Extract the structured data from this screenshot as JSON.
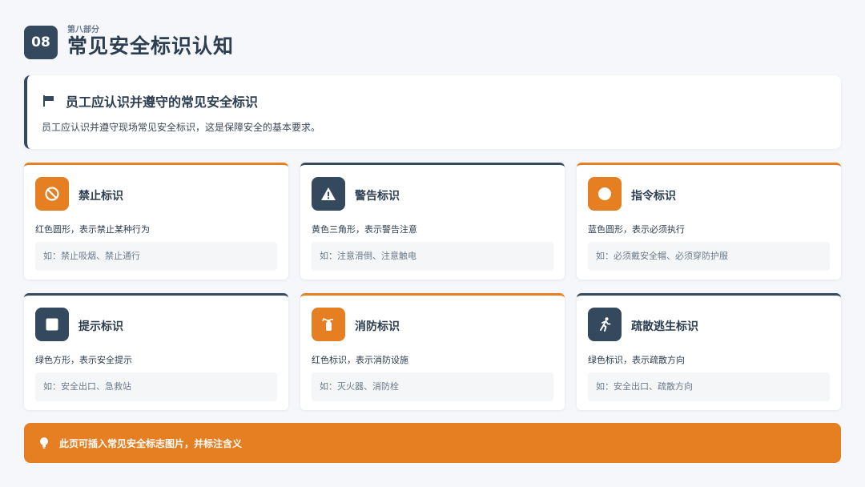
{
  "header": {
    "number": "08",
    "section_label": "第八部分",
    "title": "常见安全标识认知"
  },
  "intro": {
    "icon": "flag-icon",
    "title": "员工应认识并遵守的常见安全标识",
    "text": "员工应认识并遵守现场常见安全标识，这是保障安全的基本要求。"
  },
  "cards": [
    {
      "title": "禁止标识",
      "description": "红色圆形，表示禁止某种行为",
      "example": "如：禁止吸烟、禁止通行",
      "icon": "ban-icon",
      "accent": "#e67e22"
    },
    {
      "title": "警告标识",
      "description": "黄色三角形，表示警告注意",
      "example": "如：注意滑倒、注意触电",
      "icon": "warning-icon",
      "accent": "#34495e"
    },
    {
      "title": "指令标识",
      "description": "蓝色圆形，表示必须执行",
      "example": "如：必须戴安全帽、必须穿防护服",
      "icon": "circle-icon",
      "accent": "#e67e22"
    },
    {
      "title": "提示标识",
      "description": "绿色方形，表示安全提示",
      "example": "如：安全出口、急救站",
      "icon": "square-icon",
      "accent": "#34495e"
    },
    {
      "title": "消防标识",
      "description": "红色标识，表示消防设施",
      "example": "如：灭火器、消防栓",
      "icon": "fire-extinguisher-icon",
      "accent": "#e67e22"
    },
    {
      "title": "疏散逃生标识",
      "description": "绿色标识，表示疏散方向",
      "example": "如：安全出口、疏散方向",
      "icon": "running-person-icon",
      "accent": "#34495e"
    }
  ],
  "tip": {
    "icon": "lightbulb-icon",
    "text": "此页可插入常见安全标志图片，并标注含义"
  },
  "colors": {
    "navy": "#34495e",
    "orange": "#e67e22",
    "background": "#f5f7fa"
  }
}
